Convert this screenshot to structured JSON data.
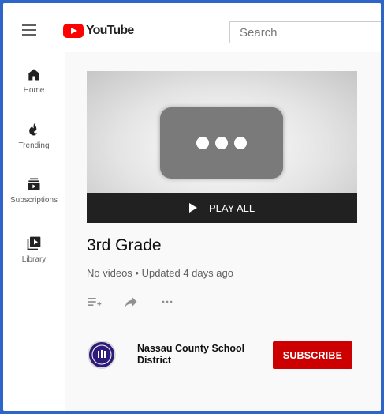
{
  "header": {
    "logo_text": "YouTube",
    "search_placeholder": "Search"
  },
  "sidebar": {
    "items": [
      {
        "label": "Home",
        "icon": "home-icon"
      },
      {
        "label": "Trending",
        "icon": "trending-icon"
      },
      {
        "label": "Subscriptions",
        "icon": "subscriptions-icon"
      },
      {
        "label": "Library",
        "icon": "library-icon"
      }
    ]
  },
  "playlist": {
    "play_all_label": "PLAY ALL",
    "title": "3rd Grade",
    "meta": "No videos • Updated 4 days ago"
  },
  "channel": {
    "name": "Nassau County School District",
    "subscribe_label": "SUBSCRIBE"
  },
  "colors": {
    "brand_red": "#ff0000",
    "subscribe_red": "#cc0000",
    "frame_blue": "#2f64c8"
  }
}
